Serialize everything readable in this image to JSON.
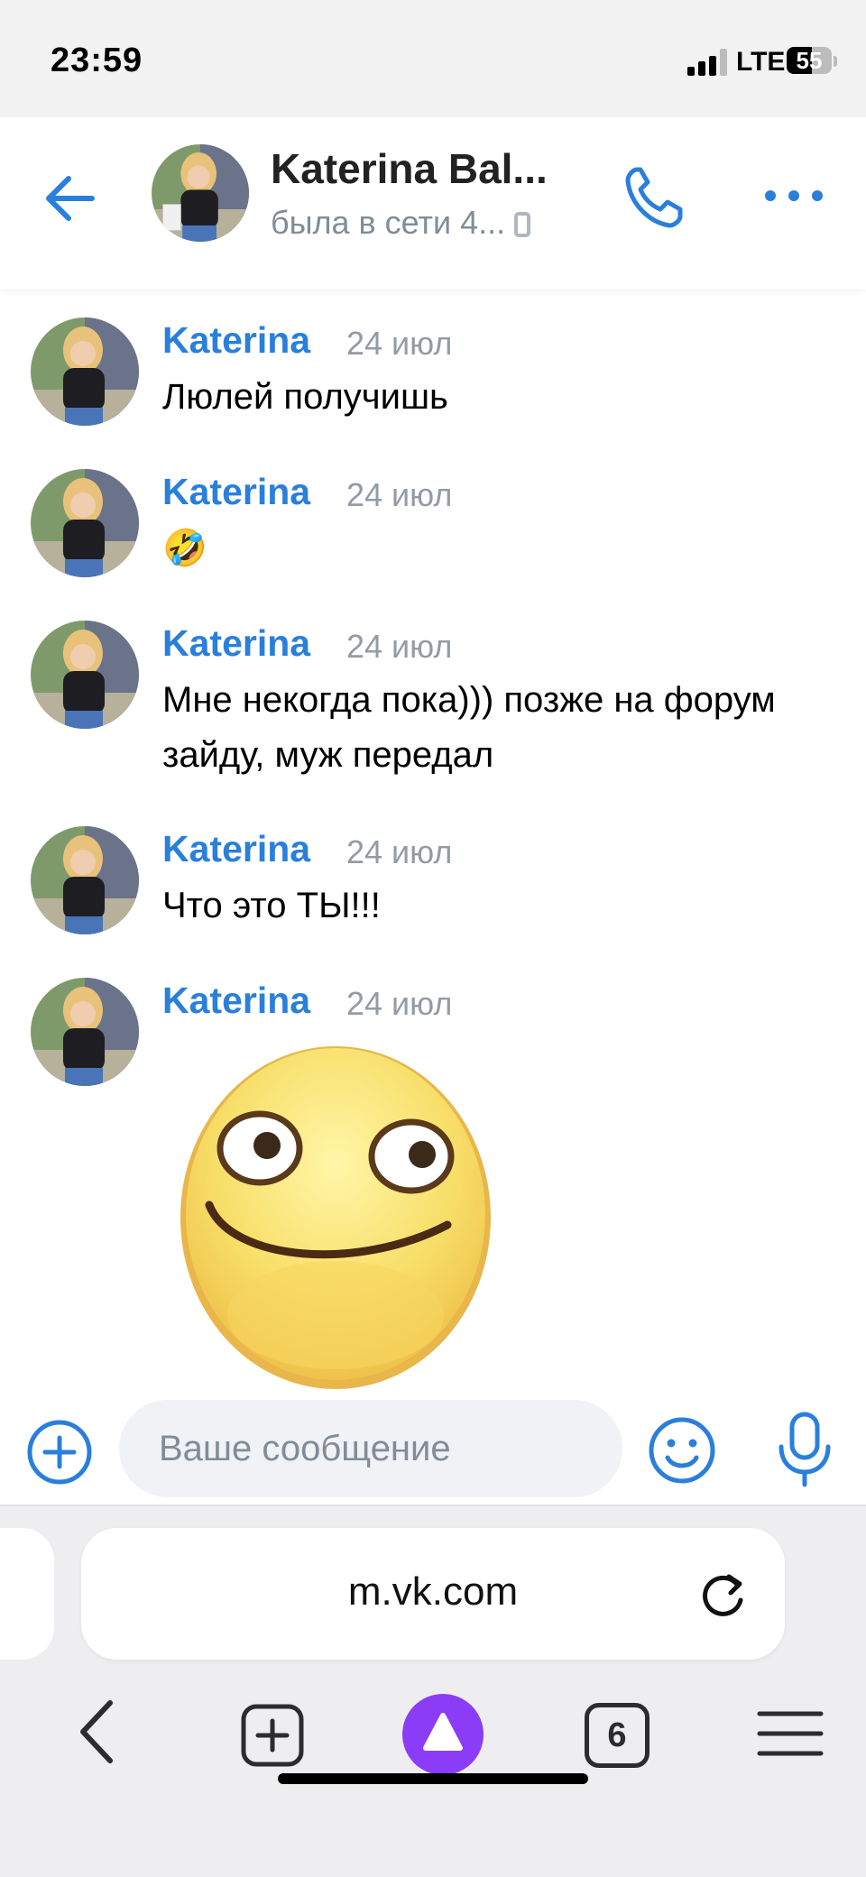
{
  "status_bar": {
    "time": "23:59",
    "network": "LTE",
    "battery": "55"
  },
  "header": {
    "name": "Katerina Bal...",
    "status": "была в сети 4...",
    "back_icon": "arrow-left-icon",
    "call_icon": "phone-icon",
    "more_icon": "more-dots-icon"
  },
  "messages": [
    {
      "author": "Katerina",
      "date": "24 июл",
      "text": "Люлей получишь"
    },
    {
      "author": "Katerina",
      "date": "24 июл",
      "text": "🤣"
    },
    {
      "author": "Katerina",
      "date": "24 июл",
      "text": "Мне некогда пока))) позже на форум зайду, муж передал"
    },
    {
      "author": "Katerina",
      "date": "24 июл",
      "text": "Что это ТЫ!!!"
    },
    {
      "author": "Katerina",
      "date": "24 июл",
      "sticker": "smiley-sticker"
    }
  ],
  "composer": {
    "placeholder": "Ваше сообщение"
  },
  "browser": {
    "url": "m.vk.com",
    "tab_count": "6"
  },
  "colors": {
    "accent": "#2a7fdb",
    "alice": "#8b3cf7",
    "muted": "#939ba5"
  }
}
